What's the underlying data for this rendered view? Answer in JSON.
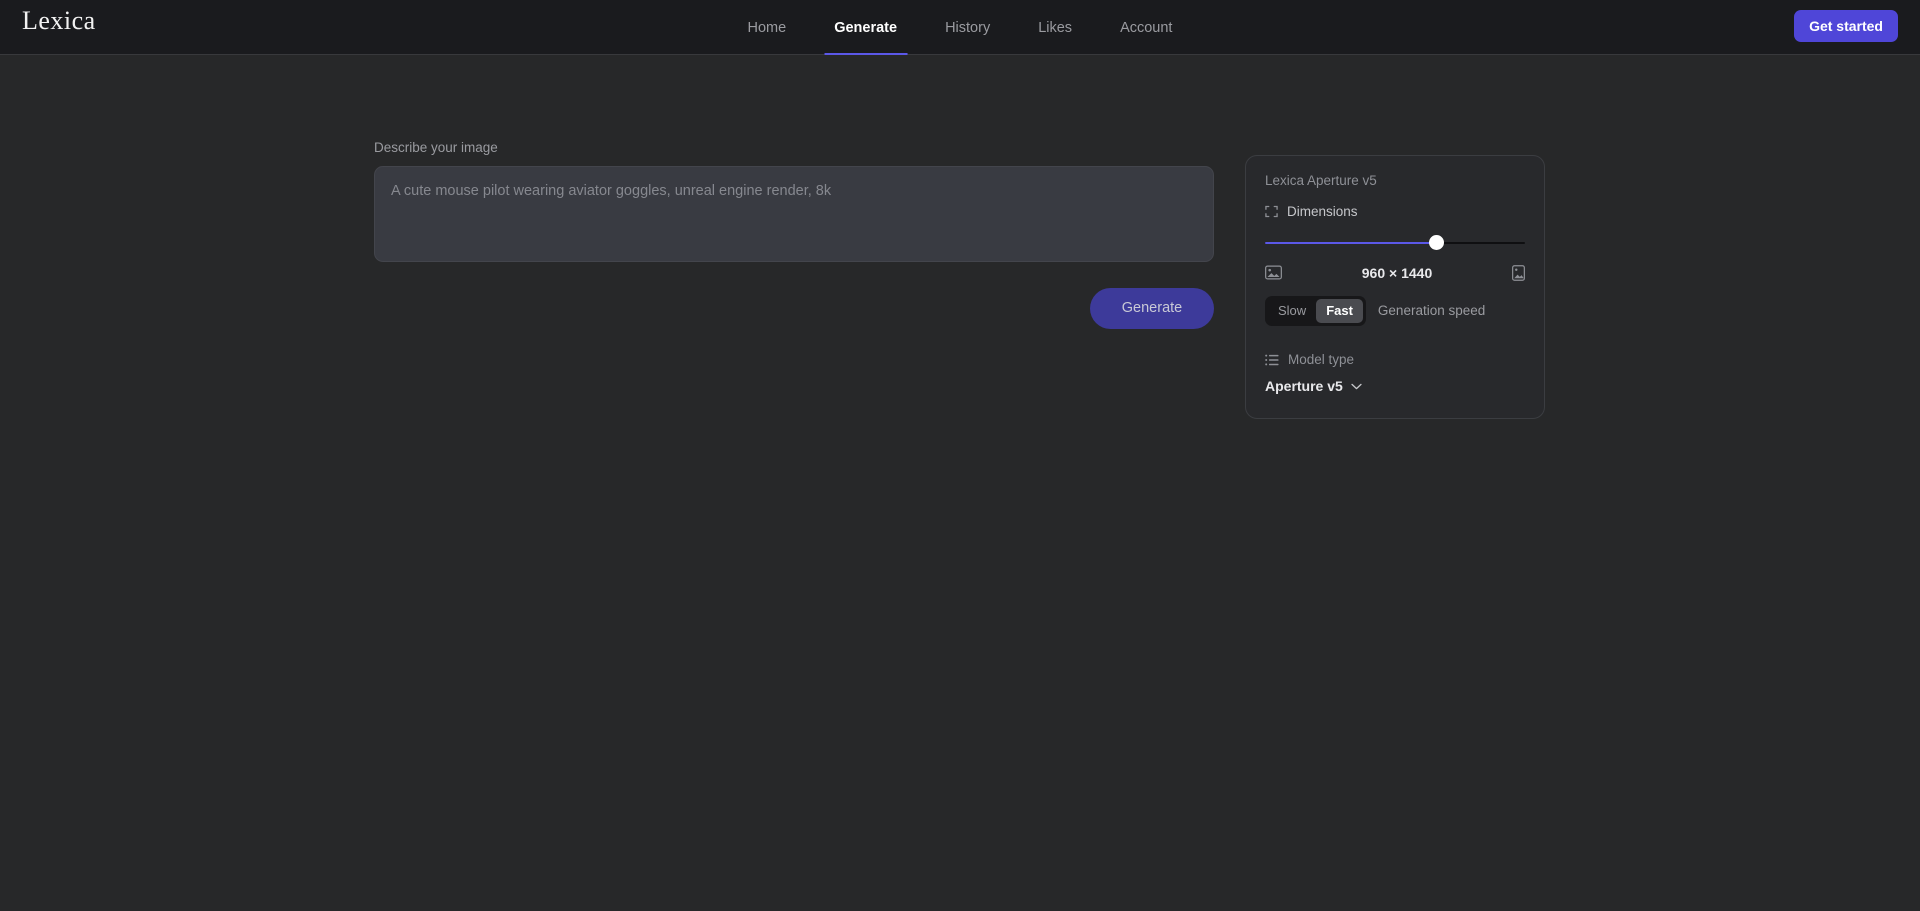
{
  "header": {
    "brand": "Lexica",
    "nav": [
      {
        "label": "Home",
        "active": false
      },
      {
        "label": "Generate",
        "active": true
      },
      {
        "label": "History",
        "active": false
      },
      {
        "label": "Likes",
        "active": false
      },
      {
        "label": "Account",
        "active": false
      }
    ],
    "cta_label": "Get started",
    "accent_color": "#4f46d8"
  },
  "compose": {
    "prompt_label": "Describe your image",
    "prompt_value": "",
    "prompt_placeholder": "A cute mouse pilot wearing aviator goggles, unreal engine render, 8k",
    "generate_label": "Generate"
  },
  "settings": {
    "panel_title": "Lexica Aperture v5",
    "dimensions": {
      "label": "Dimensions",
      "icon": "expand-corners-icon",
      "value": "960 × 1440",
      "slider_percent": 66,
      "slider_fill_color": "#5b58e8",
      "landscape_icon": "landscape-image-icon",
      "portrait_icon": "portrait-image-icon"
    },
    "generation_speed": {
      "label": "Generation speed",
      "options": [
        "Slow",
        "Fast"
      ],
      "selected": "Fast"
    },
    "model_type": {
      "label": "Model type",
      "icon": "list-icon",
      "selected": "Aperture v5"
    }
  }
}
